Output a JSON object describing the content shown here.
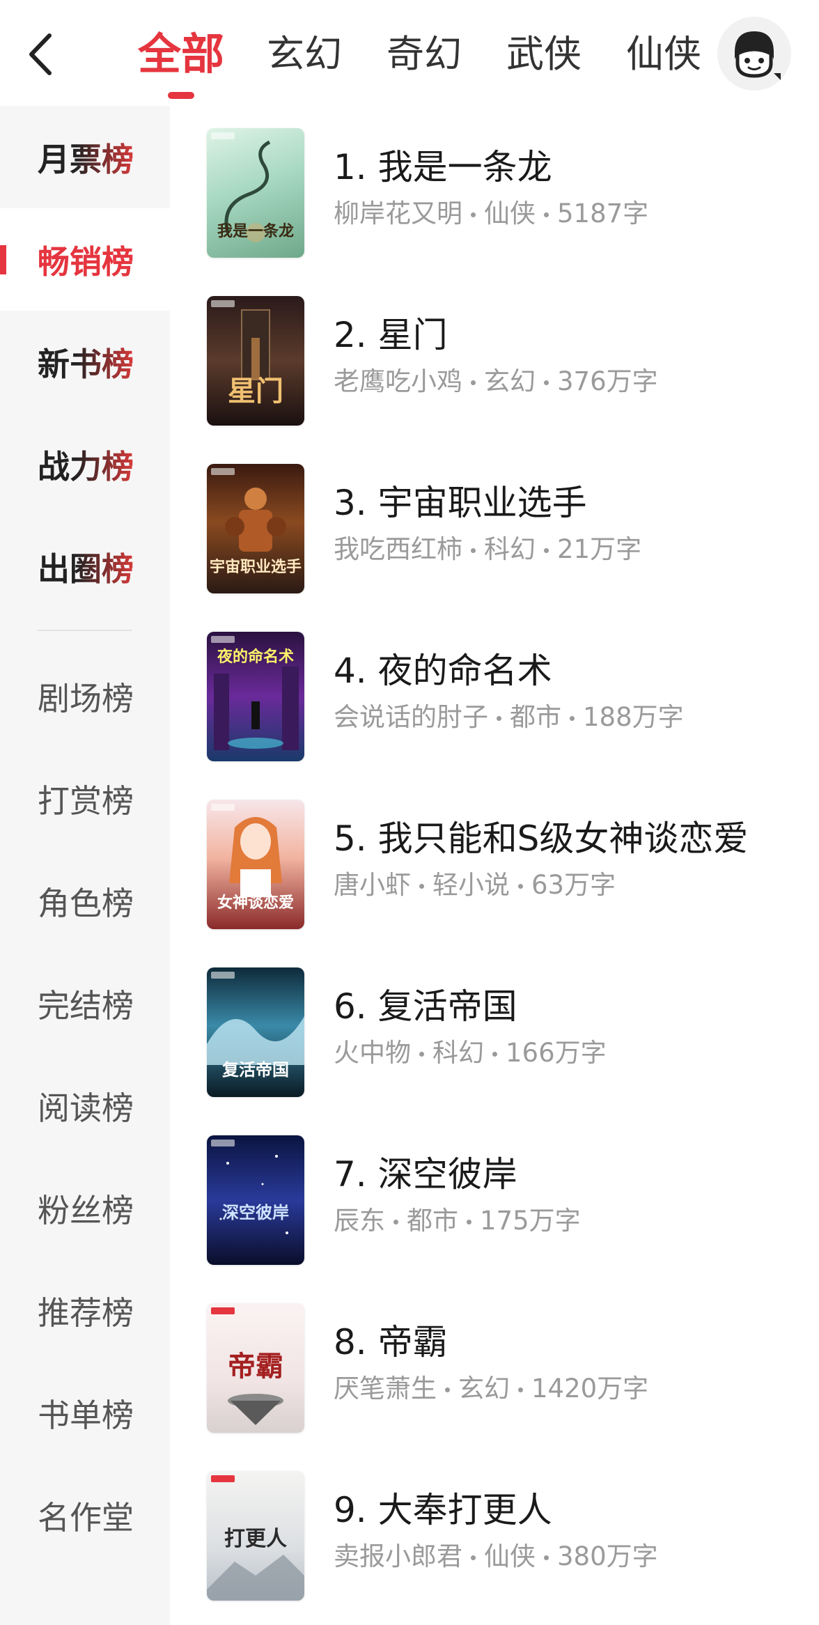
{
  "header": {
    "tabs": [
      {
        "label": "全部",
        "active": true
      },
      {
        "label": "玄幻",
        "active": false
      },
      {
        "label": "奇幻",
        "active": false
      },
      {
        "label": "武侠",
        "active": false
      },
      {
        "label": "仙侠",
        "active": false
      }
    ],
    "back_icon": "chevron-left-icon",
    "avatar_icon": "user-avatar-icon"
  },
  "sidebar": {
    "major_items": [
      {
        "label": "月票榜",
        "active": false
      },
      {
        "label": "畅销榜",
        "active": true
      },
      {
        "label": "新书榜",
        "active": false
      },
      {
        "label": "战力榜",
        "active": false
      },
      {
        "label": "出圈榜",
        "active": false
      }
    ],
    "minor_items": [
      {
        "label": "剧场榜"
      },
      {
        "label": "打赏榜"
      },
      {
        "label": "角色榜"
      },
      {
        "label": "完结榜"
      },
      {
        "label": "阅读榜"
      },
      {
        "label": "粉丝榜"
      },
      {
        "label": "推荐榜"
      },
      {
        "label": "书单榜"
      },
      {
        "label": "名作堂"
      }
    ]
  },
  "books": [
    {
      "title": "1. 我是一条龙",
      "author": "柳岸花又明",
      "genre": "仙侠",
      "length": "5187字",
      "cover_text": "我是一条龙"
    },
    {
      "title": "2. 星门",
      "author": "老鹰吃小鸡",
      "genre": "玄幻",
      "length": "376万字",
      "cover_text": "星门"
    },
    {
      "title": "3. 宇宙职业选手",
      "author": "我吃西红柿",
      "genre": "科幻",
      "length": "21万字",
      "cover_text": "宇宙职业选手"
    },
    {
      "title": "4. 夜的命名术",
      "author": "会说话的肘子",
      "genre": "都市",
      "length": "188万字",
      "cover_text": "夜的命名术"
    },
    {
      "title": "5. 我只能和S级女神谈恋爱",
      "author": "唐小虾",
      "genre": "轻小说",
      "length": "63万字",
      "cover_text": "女神谈恋爱"
    },
    {
      "title": "6. 复活帝国",
      "author": "火中物",
      "genre": "科幻",
      "length": "166万字",
      "cover_text": "复活帝国"
    },
    {
      "title": "7. 深空彼岸",
      "author": "辰东",
      "genre": "都市",
      "length": "175万字",
      "cover_text": "深空彼岸"
    },
    {
      "title": "8. 帝霸",
      "author": "厌笔萧生",
      "genre": "玄幻",
      "length": "1420万字",
      "cover_text": "帝霸"
    },
    {
      "title": "9. 大奉打更人",
      "author": "卖报小郎君",
      "genre": "仙侠",
      "length": "380万字",
      "cover_text": "打更人"
    }
  ],
  "colors": {
    "accent": "#e5353f",
    "sidebar_bg": "#f6f6f6",
    "meta_text": "#9a9a9a"
  }
}
